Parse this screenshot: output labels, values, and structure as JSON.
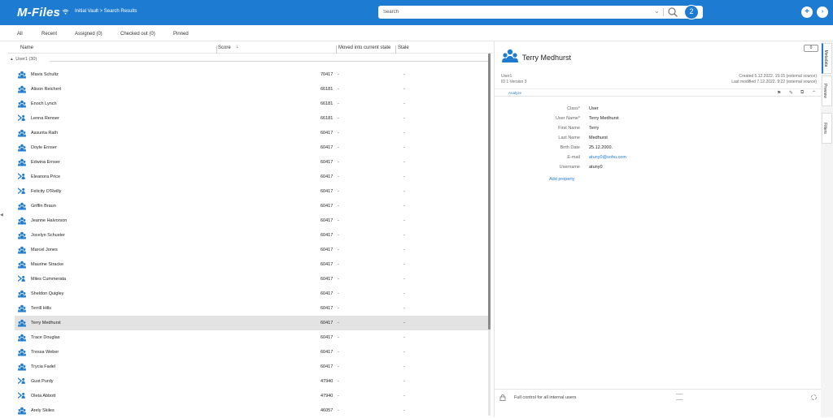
{
  "header": {
    "logo": "M-Files",
    "breadcrumb": "Initial Vault > Search Results",
    "search_placeholder": "Search",
    "search_count": "2",
    "accent": "#1e7bd2"
  },
  "tabs": [
    {
      "label": "All"
    },
    {
      "label": "Recent"
    },
    {
      "label": "Assigned (0)"
    },
    {
      "label": "Checked out (0)"
    },
    {
      "label": "Pinned"
    }
  ],
  "columns": {
    "name": "Name",
    "score": "Score",
    "moved": "Moved into current state",
    "stale": "Stale"
  },
  "group_label": "User1 (30)",
  "rows": [
    {
      "name": "Mavis Schultz",
      "score": "70417",
      "moved": "-",
      "stale": "-",
      "icon": "users-icon"
    },
    {
      "name": "Alison Reichert",
      "score": "66181",
      "moved": "-",
      "stale": "-",
      "icon": "users-icon"
    },
    {
      "name": "Enoch Lynch",
      "score": "66181",
      "moved": "-",
      "stale": "-",
      "icon": "users-icon"
    },
    {
      "name": "Lenna Renner",
      "score": "66181",
      "moved": "-",
      "stale": "-",
      "icon": "external-user-icon"
    },
    {
      "name": "Assunta Rath",
      "score": "60417",
      "moved": "-",
      "stale": "-",
      "icon": "users-icon"
    },
    {
      "name": "Doyle Ernser",
      "score": "60417",
      "moved": "-",
      "stale": "-",
      "icon": "users-icon"
    },
    {
      "name": "Edwina Ernser",
      "score": "60417",
      "moved": "-",
      "stale": "-",
      "icon": "users-icon"
    },
    {
      "name": "Eleanora Price",
      "score": "60417",
      "moved": "-",
      "stale": "-",
      "icon": "external-user-icon"
    },
    {
      "name": "Felicity O'Reilly",
      "score": "60417",
      "moved": "-",
      "stale": "-",
      "icon": "external-user-icon"
    },
    {
      "name": "Griffin Braun",
      "score": "60417",
      "moved": "-",
      "stale": "-",
      "icon": "users-icon"
    },
    {
      "name": "Jeanne Halvorson",
      "score": "60417",
      "moved": "-",
      "stale": "-",
      "icon": "users-icon"
    },
    {
      "name": "Jocelyn Schuster",
      "score": "60417",
      "moved": "-",
      "stale": "-",
      "icon": "users-icon"
    },
    {
      "name": "Marcel Jones",
      "score": "60417",
      "moved": "-",
      "stale": "-",
      "icon": "users-icon"
    },
    {
      "name": "Maurine Stracke",
      "score": "60417",
      "moved": "-",
      "stale": "-",
      "icon": "users-icon"
    },
    {
      "name": "Miles Cummerata",
      "score": "60417",
      "moved": "-",
      "stale": "-",
      "icon": "external-user-icon"
    },
    {
      "name": "Sheldon Quigley",
      "score": "60417",
      "moved": "-",
      "stale": "-",
      "icon": "users-icon"
    },
    {
      "name": "Terrill Hills",
      "score": "60417",
      "moved": "-",
      "stale": "-",
      "icon": "users-icon"
    },
    {
      "name": "Terry Medhurst",
      "score": "60417",
      "moved": "-",
      "stale": "-",
      "icon": "users-icon",
      "selected": true
    },
    {
      "name": "Trace Douglas",
      "score": "60417",
      "moved": "-",
      "stale": "-",
      "icon": "users-icon"
    },
    {
      "name": "Tressa Weber",
      "score": "60417",
      "moved": "-",
      "stale": "-",
      "icon": "users-icon"
    },
    {
      "name": "Trycia Fadel",
      "score": "60417",
      "moved": "-",
      "stale": "-",
      "icon": "users-icon"
    },
    {
      "name": "Gust Purdy",
      "score": "47940",
      "moved": "-",
      "stale": "-",
      "icon": "external-user-icon"
    },
    {
      "name": "Oleta Abbott",
      "score": "47940",
      "moved": "-",
      "stale": "-",
      "icon": "external-user-icon"
    },
    {
      "name": "Arely Skiles",
      "score": "46057",
      "moved": "-",
      "stale": "-",
      "icon": "users-icon"
    }
  ],
  "detail": {
    "title": "Terry Medhurst",
    "badge": "0",
    "object_type": "User1",
    "id_version": "ID 1  Version 3",
    "created": "Created 5.12.2022. 15:15 (external source)",
    "modified": "Last modified 7.12.2022. 9:22 (external source)",
    "analyze": "Analyze",
    "properties": [
      {
        "label": "Class*",
        "value": "User",
        "link": false
      },
      {
        "label": "User Name*",
        "value": "Terry Medhurst",
        "link": false
      },
      {
        "label": "First Name",
        "value": "Terry",
        "link": false
      },
      {
        "label": "Last Name",
        "value": "Medhurst",
        "link": false
      },
      {
        "label": "Birth Date",
        "value": "25.12.2000.",
        "link": false
      },
      {
        "label": "E-mail",
        "value": "atuny0@sohu.com",
        "link": true
      },
      {
        "label": "Username",
        "value": "atuny0",
        "link": false
      }
    ],
    "add_property": "Add property",
    "permissions": "Full control for all internal users",
    "dash1": "___",
    "dash2": "___"
  },
  "side_tabs": [
    {
      "label": "Metadata"
    },
    {
      "label": "Preview"
    },
    {
      "label": "Filters"
    }
  ]
}
